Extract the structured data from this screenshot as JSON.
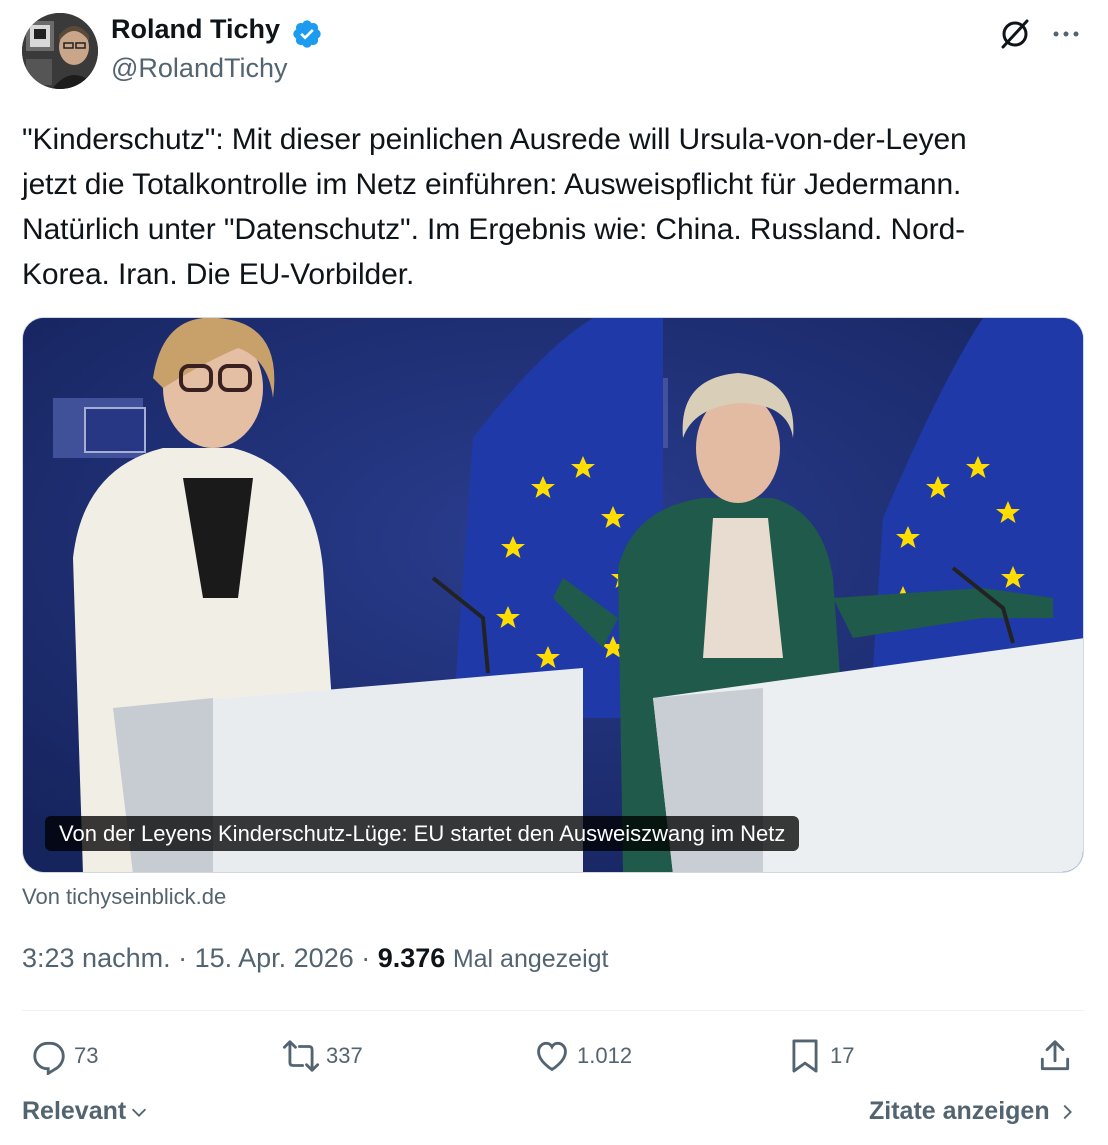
{
  "author": {
    "name": "Roland Tichy",
    "handle": "@RolandTichy",
    "verified_color": "#1d9bf0"
  },
  "tweet": {
    "text": "\"Kinderschutz\": Mit dieser peinlichen Ausrede will Ursula-von-der-Leyen\njetzt die Totalkontrolle im Netz einführen: Ausweispflicht für Jedermann.\nNatürlich unter \"Datenschutz\". Im Ergebnis wie: China. Russland. Nord-\nKorea. Iran. Die EU-Vorbilder."
  },
  "card": {
    "caption": "Von der Leyens Kinderschutz-Lüge: EU startet den Ausweiszwang im Netz",
    "source": "Von tichyseinblick.de"
  },
  "meta": {
    "time": "3:23 nachm.",
    "separator": " · ",
    "date": "15. Apr. 2026",
    "views": "9.376",
    "views_label": "Mal angezeigt"
  },
  "actions": {
    "replies": "73",
    "reposts": "337",
    "likes": "1.012",
    "bookmarks": "17"
  },
  "footer": {
    "sort_label": "Relevant",
    "quotes_label": "Zitate anzeigen"
  },
  "icons": [
    "verified-badge-icon",
    "grok-icon",
    "more-icon",
    "reply-icon",
    "repost-icon",
    "like-icon",
    "bookmark-icon",
    "share-icon",
    "chevron-down-icon",
    "chevron-right-icon"
  ],
  "colors": {
    "text": "#0f1419",
    "secondary": "#536471",
    "brand": "#1d9bf0",
    "eu_blue": "#1b2a8a",
    "eu_star": "#ffdd00"
  }
}
